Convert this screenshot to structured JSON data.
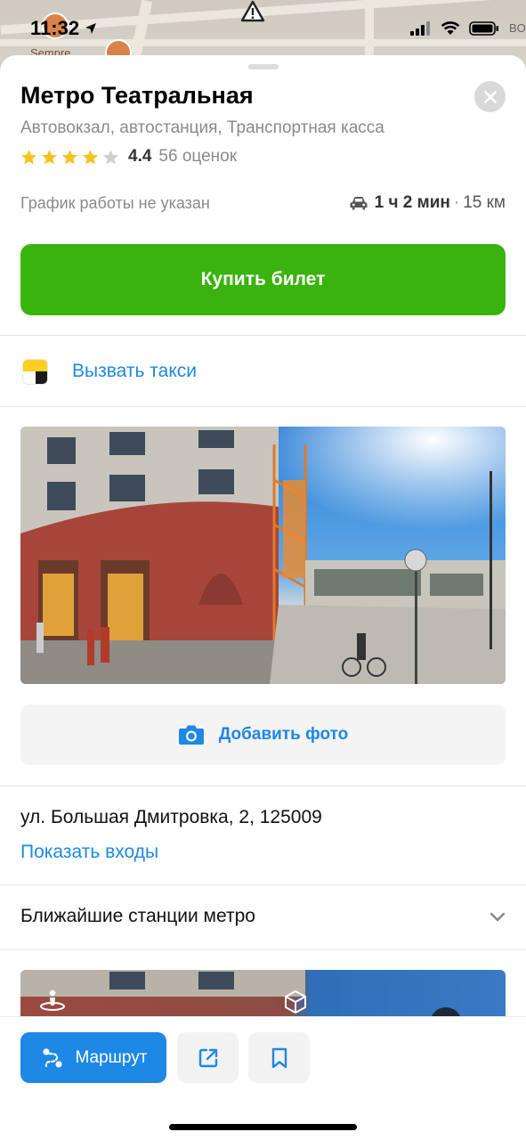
{
  "status_bar": {
    "time": "11:32"
  },
  "map": {
    "poi_label": "Sempre",
    "edge_label": "BO"
  },
  "place": {
    "title": "Метро Театральная",
    "categories": "Автовокзал, автостанция, Транспортная касса",
    "rating": {
      "stars_filled": 4,
      "stars_total": 5,
      "value": "4.4",
      "count": "56 оценок"
    },
    "hours": "График работы не указан",
    "travel": {
      "time": "1 ч 2 мин",
      "separator": "·",
      "distance": "15 км"
    }
  },
  "actions": {
    "buy_ticket": "Купить билет",
    "call_taxi": "Вызвать такси",
    "add_photo": "Добавить фото"
  },
  "address": {
    "line": "ул. Большая Дмитровка, 2,  125009",
    "show_entrances": "Показать входы"
  },
  "nearby_metro": {
    "label": "Ближайшие станции метро"
  },
  "bottom_bar": {
    "route": "Маршрут"
  },
  "colors": {
    "accent_green": "#3bb30e",
    "link_blue": "#1e88e5",
    "star_yellow": "#f6c21c",
    "taxi_yellow": "#ffcf1f"
  },
  "icons": {
    "close": "close-icon",
    "car": "car-icon",
    "camera": "camera-icon",
    "share": "share-icon",
    "bookmark": "bookmark-icon",
    "route": "route-icon",
    "chevron": "chevron-down-icon",
    "panorama": "panorama-icon",
    "ar": "ar-cube-icon"
  }
}
